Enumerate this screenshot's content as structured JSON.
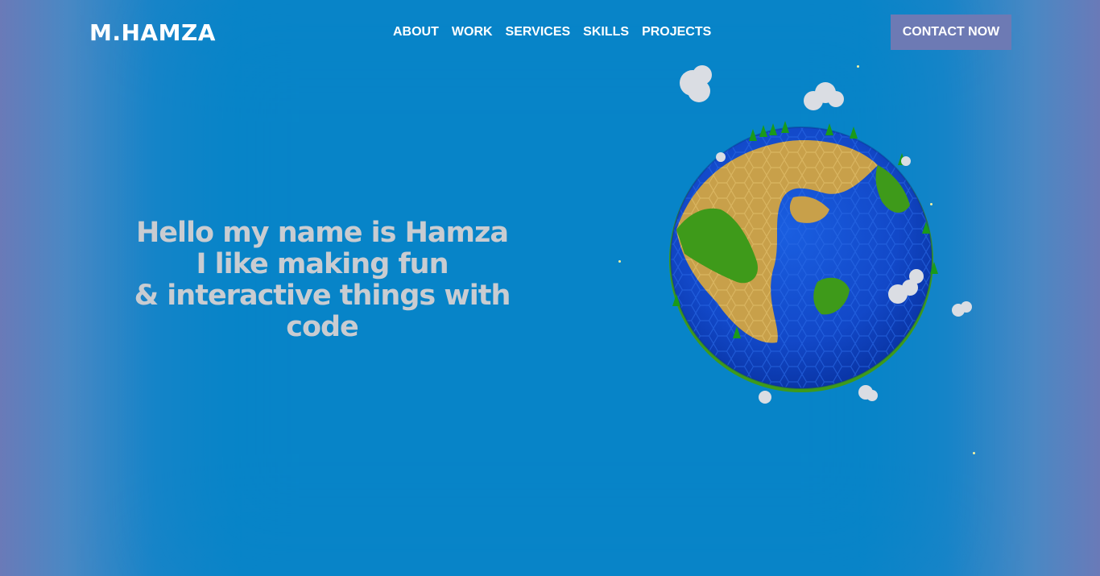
{
  "header": {
    "logo": "M.HAMZA",
    "nav": [
      "ABOUT",
      "WORK",
      "SERVICES",
      "SKILLS",
      "PROJECTS"
    ],
    "cta_label": "CONTACT NOW"
  },
  "hero": {
    "lines": [
      "Hello my name is Hamza",
      "I like making fun",
      "& interactive things with",
      "code"
    ]
  },
  "colors": {
    "background": "#0684c8",
    "edge": "#6a7ab8",
    "cta": "#6d7ab4",
    "hero_text": "#c9ccd1",
    "ocean": "#1a4fd0",
    "land": "#c8a04a",
    "grass": "#3e9a1a"
  }
}
